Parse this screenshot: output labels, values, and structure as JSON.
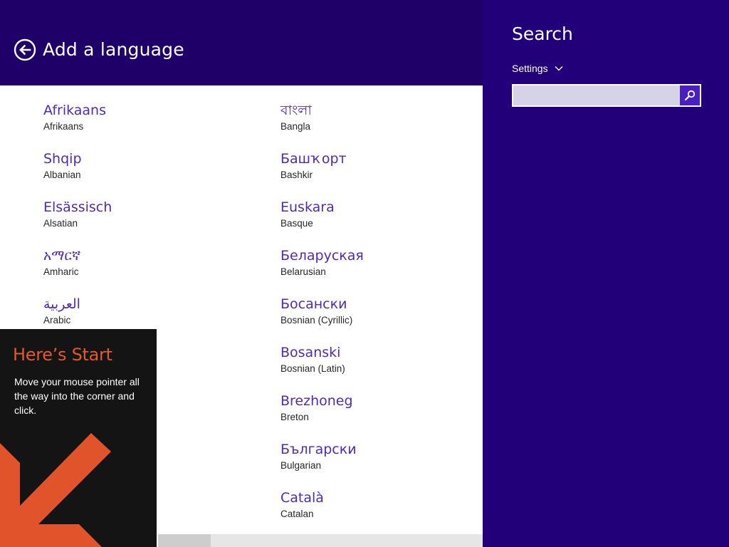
{
  "header": {
    "title": "Add a language"
  },
  "languages": {
    "column1": [
      {
        "native": "Afrikaans",
        "english": "Afrikaans"
      },
      {
        "native": "Shqip",
        "english": "Albanian"
      },
      {
        "native": "Elsässisch",
        "english": "Alsatian"
      },
      {
        "native": "አማርኛ",
        "english": "Amharic"
      },
      {
        "native": "العربية",
        "english": "Arabic"
      }
    ],
    "column2": [
      {
        "native": "বাংলা",
        "english": "Bangla"
      },
      {
        "native": "Башҡорт",
        "english": "Bashkir"
      },
      {
        "native": "Euskara",
        "english": "Basque"
      },
      {
        "native": "Беларуская",
        "english": "Belarusian"
      },
      {
        "native": "Босански",
        "english": "Bosnian (Cyrillic)"
      },
      {
        "native": "Bosanski",
        "english": "Bosnian (Latin)"
      },
      {
        "native": "Brezhoneg",
        "english": "Breton"
      },
      {
        "native": "Български",
        "english": "Bulgarian"
      },
      {
        "native": "Català",
        "english": "Catalan"
      }
    ]
  },
  "tip": {
    "title": "Here’s Start",
    "text": "Move your mouse pointer all the way into the corner and click."
  },
  "search_pane": {
    "title": "Search",
    "scope": "Settings",
    "query": ""
  },
  "colors": {
    "charm_bg": "#22007a",
    "header_bg": "#1f0068",
    "accent_text": "#4d2bb5",
    "tip_title": "#e35a2a",
    "tip_arrow": "#e0532b"
  },
  "icons": {
    "back": "back-arrow-circle-icon",
    "search": "magnifier-icon",
    "dropdown": "chevron-down-icon",
    "tip_arrow": "diagonal-arrow-icon"
  }
}
